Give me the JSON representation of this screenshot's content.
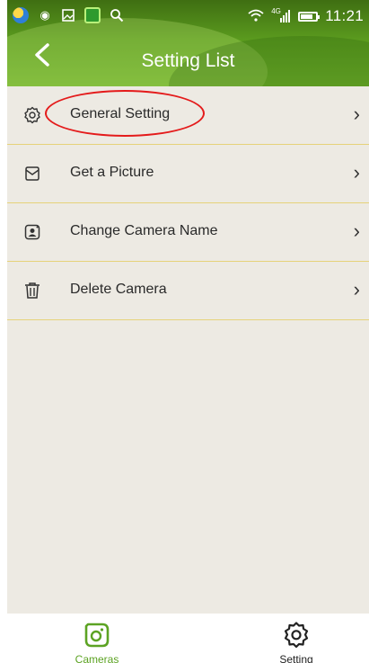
{
  "status_bar": {
    "time": "11:21",
    "network": "4G",
    "icons": [
      "app-icon",
      "alert-icon",
      "image-icon",
      "refresh-app-icon",
      "search-icon",
      "wifi-icon",
      "signal-icon",
      "battery-icon"
    ]
  },
  "header": {
    "title": "Setting List"
  },
  "list": {
    "items": [
      {
        "label": "General Setting",
        "icon": "gear-icon"
      },
      {
        "label": "Get a Picture",
        "icon": "picture-icon"
      },
      {
        "label": "Change Camera Name",
        "icon": "camera-name-icon"
      },
      {
        "label": "Delete Camera",
        "icon": "trash-icon"
      }
    ]
  },
  "bottom_nav": {
    "cameras_label": "Cameras",
    "setting_label": "Setting"
  },
  "colors": {
    "header_green": "#5a9a1e",
    "accent_green": "#5ca323",
    "background": "#edeae3",
    "divider": "#e6d27a",
    "annotation_red": "#e41b1b"
  }
}
